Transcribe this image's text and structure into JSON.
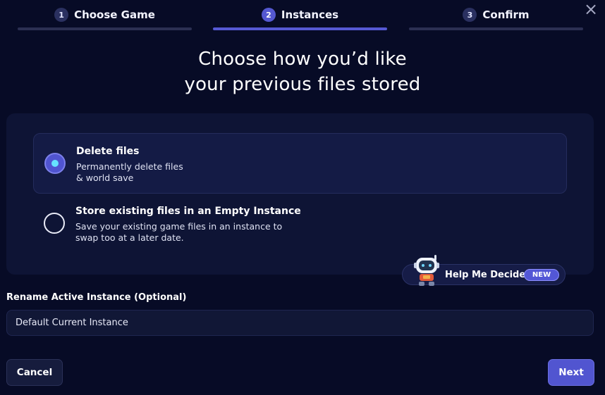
{
  "stepper": {
    "steps": [
      {
        "number": "1",
        "label": "Choose Game",
        "active": false
      },
      {
        "number": "2",
        "label": "Instances",
        "active": true
      },
      {
        "number": "3",
        "label": "Confirm",
        "active": false
      }
    ],
    "close_icon": "×"
  },
  "title": {
    "line1": "Choose how you’d like",
    "line2": "your previous files stored"
  },
  "options": [
    {
      "title": "Delete files",
      "description": "Permanently delete files\n& world save",
      "selected": true
    },
    {
      "title": "Store existing files in an Empty Instance",
      "description": "Save your existing game files in an instance to\nswap too at a later date.",
      "selected": false
    }
  ],
  "help": {
    "label": "Help Me Decide",
    "badge": "NEW",
    "icon": "robot-icon"
  },
  "rename": {
    "label": "Rename Active Instance (Optional)",
    "value": "Default Current Instance"
  },
  "footer": {
    "cancel_label": "Cancel",
    "next_label": "Next"
  },
  "colors": {
    "background": "#070b26",
    "accent": "#5155d0",
    "radio_dot": "#66e3ff"
  }
}
